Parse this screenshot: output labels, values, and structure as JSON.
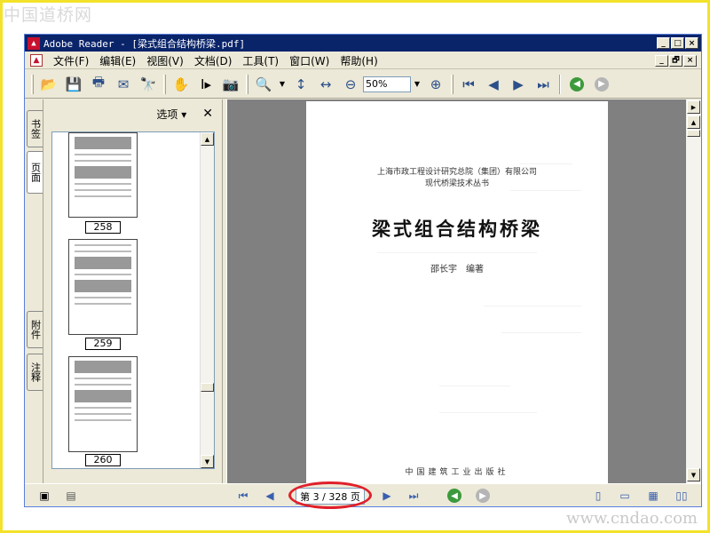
{
  "watermarks": {
    "top": "中国道桥网",
    "bottom": "www.cndao.com"
  },
  "window": {
    "title": "Adobe Reader - [梁式组合结构桥梁.pdf]",
    "buttons": {
      "minimize": "_",
      "maximize": "□",
      "close": "×",
      "restore": "🗗"
    }
  },
  "menu": {
    "items": [
      "文件(F)",
      "编辑(E)",
      "视图(V)",
      "文档(D)",
      "工具(T)",
      "窗口(W)",
      "帮助(H)"
    ]
  },
  "toolbar": {
    "zoom_value": "50%",
    "icons": [
      "open-icon",
      "save-icon",
      "print-icon",
      "email-icon",
      "search-icon",
      "hand-icon",
      "select-text-icon",
      "snapshot-icon",
      "zoom-in-icon",
      "fit-height-icon",
      "fit-width-icon",
      "zoom-out-icon",
      "zoom-plus-icon",
      "first-page-icon",
      "prev-page-icon",
      "next-page-icon",
      "last-page-icon",
      "back-icon",
      "forward-icon"
    ]
  },
  "side_tabs": {
    "bookmarks": "书签",
    "pages": "页面",
    "attachments": "附件",
    "comments": "注释"
  },
  "nav_panel": {
    "options_label": "选项",
    "thumbnails": [
      {
        "label": "258"
      },
      {
        "label": "259"
      },
      {
        "label": "260"
      }
    ]
  },
  "page": {
    "publisher_line1": "上海市政工程设计研究总院（集团）有限公司",
    "publisher_line2": "现代桥梁技术丛书",
    "title": "梁式组合结构桥梁",
    "author": "邵长宇　编著",
    "press": "中国建筑工业出版社"
  },
  "status": {
    "page_indicator": "第 3 / 328 页",
    "highlight_color": "#e0202a"
  }
}
